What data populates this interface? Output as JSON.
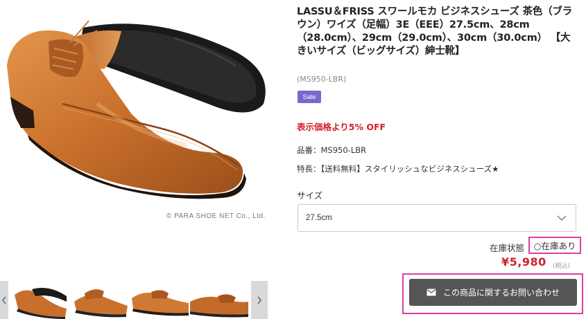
{
  "product": {
    "title": "LASSU＆FRISS スワールモカ ビジネスシューズ 茶色（ブラウン）ワイズ（足幅）3E（EEE）27.5cm、28cm（28.0cm）、29cm（29.0cm）、30cm（30.0cm） 【大きいサイズ（ビッグサイズ）紳士靴】",
    "code_sub": "(MS950-LBR)",
    "sale_badge": "Sale",
    "discount_text": "表示価格より5% OFF",
    "spec_code": "品番：MS950-LBR",
    "spec_feature": "特長：【送料無料】スタイリッシュなビジネスシューズ★",
    "size_label": "サイズ",
    "size_selected": "27.5cm",
    "stock_label": "在庫状態",
    "stock_value": "○在庫あり",
    "price": "¥5,980",
    "tax_note": "(税込)",
    "inquiry_button": "この商品に関するお問い合わせ"
  },
  "image": {
    "copyright": "© PARA SHOE NET Co., Ltd."
  },
  "colors": {
    "accent_red": "#d0202e",
    "sale_purple": "#7b68cf",
    "highlight_pink": "#e03ca5",
    "button_gray": "#555555",
    "shoe_brown": "#c86f2c"
  },
  "icons": {
    "thumb_prev": "chevron-left-icon",
    "thumb_next": "chevron-right-icon",
    "select_arrow": "chevron-down-icon",
    "inquiry": "mail-icon"
  }
}
